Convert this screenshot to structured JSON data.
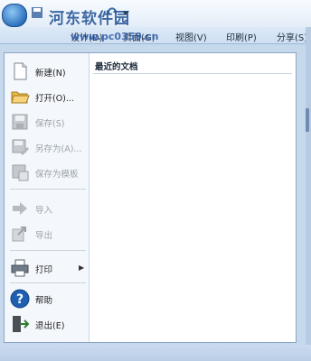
{
  "watermark": {
    "title": "河东软件园",
    "url": "www.pc0359.cn"
  },
  "ribbon": {
    "tabs": [
      {
        "label": "设计(D)"
      },
      {
        "label": "页面(G)"
      },
      {
        "label": "视图(V)"
      },
      {
        "label": "印刷(P)"
      },
      {
        "label": "分享(S)"
      }
    ]
  },
  "file_menu": {
    "items": [
      {
        "label": "新建(N)",
        "icon": "new-document-icon",
        "enabled": true
      },
      {
        "label": "打开(O)...",
        "icon": "open-folder-icon",
        "enabled": true
      },
      {
        "label": "保存(S)",
        "icon": "save-disk-icon",
        "enabled": false
      },
      {
        "label": "另存为(A)...",
        "icon": "save-as-icon",
        "enabled": false
      },
      {
        "label": "保存为模板",
        "icon": "save-as-template-icon",
        "enabled": false
      },
      {
        "label": "导入",
        "icon": "import-icon",
        "enabled": false
      },
      {
        "label": "导出",
        "icon": "export-icon",
        "enabled": false
      },
      {
        "label": "打印",
        "icon": "printer-icon",
        "enabled": true,
        "has_submenu": true
      },
      {
        "label": "帮助",
        "icon": "help-icon",
        "enabled": true
      },
      {
        "label": "退出(E)",
        "icon": "exit-icon",
        "enabled": true
      }
    ],
    "recent_documents_title": "最近的文档"
  },
  "colors": {
    "accent": "#2f73bf",
    "panel_border": "#8aa6c7",
    "disabled_text": "#9aa4ae"
  }
}
